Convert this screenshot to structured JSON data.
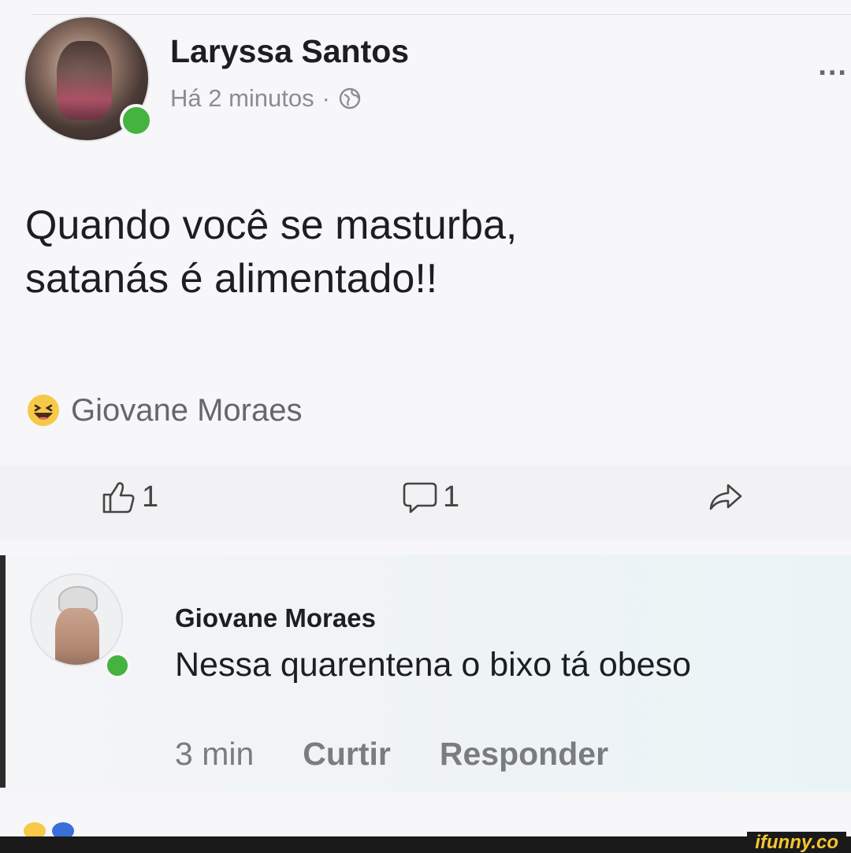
{
  "post": {
    "author": "Laryssa Santos",
    "timestamp": "Há 2 minutos",
    "separator": "·",
    "privacy_icon": "globe-icon",
    "more_label": "...",
    "text_line1": "Quando você se masturba,",
    "text_line2": "satanás é alimentado!!",
    "reaction_icon": "haha-icon",
    "reaction_name": "Giovane Moraes"
  },
  "actions": {
    "like_count": "1",
    "comment_count": "1"
  },
  "comment": {
    "author": "Giovane Moraes",
    "text": "Nessa quarentena o bixo tá obeso",
    "time": "3 min",
    "like_label": "Curtir",
    "reply_label": "Responder"
  },
  "watermark": "ifunny.co",
  "colors": {
    "online": "#44b340",
    "muted": "#8a8d91",
    "watermark": "#f5c531"
  }
}
